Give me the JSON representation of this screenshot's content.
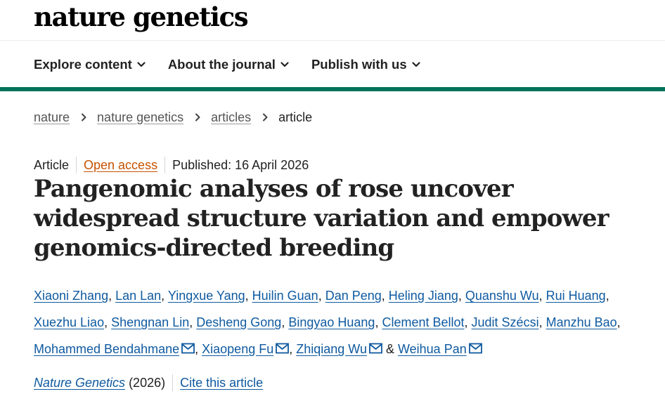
{
  "header": {
    "logo_text": "nature genetics"
  },
  "nav": {
    "items": [
      {
        "label": "Explore content"
      },
      {
        "label": "About the journal"
      },
      {
        "label": "Publish with us"
      }
    ]
  },
  "breadcrumb": {
    "items": [
      "nature",
      "nature genetics",
      "articles"
    ],
    "current": "article"
  },
  "meta": {
    "type": "Article",
    "access": "Open access",
    "published": "Published: 16 April 2026"
  },
  "title": "Pangenomic analyses of rose uncover widespread structure variation and empower genomics-directed breeding",
  "authors": [
    {
      "name": "Xiaoni Zhang",
      "email": false
    },
    {
      "name": "Lan Lan",
      "email": false
    },
    {
      "name": "Yingxue Yang",
      "email": false
    },
    {
      "name": "Huilin Guan",
      "email": false
    },
    {
      "name": "Dan Peng",
      "email": false
    },
    {
      "name": "Heling Jiang",
      "email": false
    },
    {
      "name": "Quanshu Wu",
      "email": false
    },
    {
      "name": "Rui Huang",
      "email": false
    },
    {
      "name": "Xuezhu Liao",
      "email": false
    },
    {
      "name": "Shengnan Lin",
      "email": false
    },
    {
      "name": "Desheng Gong",
      "email": false
    },
    {
      "name": "Bingyao Huang",
      "email": false
    },
    {
      "name": "Clement Bellot",
      "email": false
    },
    {
      "name": "Judit Szécsi",
      "email": false
    },
    {
      "name": "Manzhu Bao",
      "email": false
    },
    {
      "name": "Mohammed Bendahmane",
      "email": true
    },
    {
      "name": "Xiaopeng Fu",
      "email": true
    },
    {
      "name": "Zhiqiang Wu",
      "email": true
    },
    {
      "name": "Weihua Pan",
      "email": true
    }
  ],
  "citation": {
    "journal": "Nature Genetics",
    "year": "(2026)",
    "cite_label": "Cite this article"
  },
  "colors": {
    "brand_green": "#00735a",
    "link_blue": "#0f5aa0",
    "open_access_orange": "#c65301"
  },
  "icons": {
    "nav_chevron": "chevron-down-icon",
    "breadcrumb_separator": "chevron-right-icon",
    "author_contact": "mail-icon"
  }
}
